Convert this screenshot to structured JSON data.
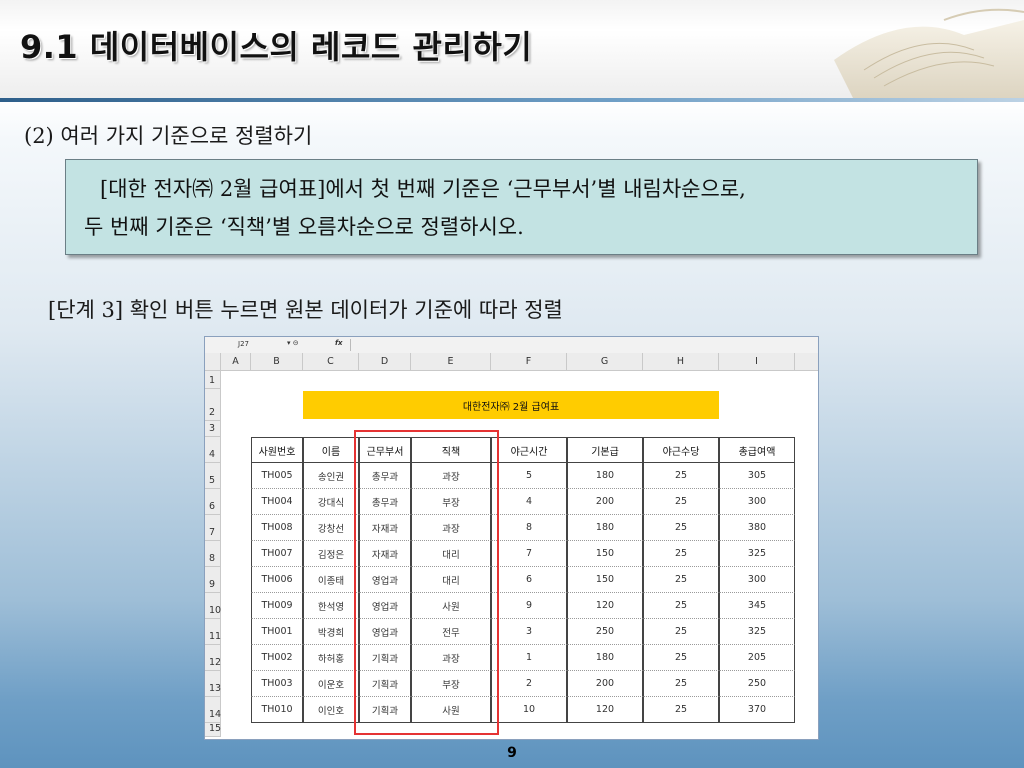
{
  "slide": {
    "title": "9.1 데이터베이스의 레코드 관리하기",
    "subtitle": "(2) 여러 가지 기준으로 정렬하기",
    "instruction_line1": "[대한 전자㈜ 2월 급여표]에서 첫 번째 기준은 ‘근무부서’별 내림차순으로,",
    "instruction_line2": "두 번째 기준은 ‘직책’별 오름차순으로 정렬하시오.",
    "step": "[단계 3] 확인 버튼 누르면 원본 데이터가 기준에 따라 정렬",
    "page_number": "9",
    "highlight_color": "#e53333"
  },
  "sheet": {
    "name_box": "J27",
    "fx_label": "fx",
    "columns": [
      "A",
      "B",
      "C",
      "D",
      "E",
      "F",
      "G",
      "H",
      "I"
    ],
    "rows": [
      "1",
      "2",
      "3",
      "4",
      "5",
      "6",
      "7",
      "8",
      "9",
      "10",
      "11",
      "12",
      "13",
      "14",
      "15"
    ],
    "table_title": "대한전자㈜ 2월 급여표",
    "title_fill": "#ffcc00",
    "headers": [
      "사원번호",
      "이름",
      "근무부서",
      "직책",
      "야근시간",
      "기본급",
      "야근수당",
      "총급여액"
    ],
    "records": [
      [
        "TH005",
        "송인권",
        "총무과",
        "과장",
        "5",
        "180",
        "25",
        "305"
      ],
      [
        "TH004",
        "강대식",
        "총무과",
        "부장",
        "4",
        "200",
        "25",
        "300"
      ],
      [
        "TH008",
        "강창선",
        "자재과",
        "과장",
        "8",
        "180",
        "25",
        "380"
      ],
      [
        "TH007",
        "김정은",
        "자재과",
        "대리",
        "7",
        "150",
        "25",
        "325"
      ],
      [
        "TH006",
        "이종태",
        "영업과",
        "대리",
        "6",
        "150",
        "25",
        "300"
      ],
      [
        "TH009",
        "한석영",
        "영업과",
        "사원",
        "9",
        "120",
        "25",
        "345"
      ],
      [
        "TH001",
        "박경희",
        "영업과",
        "전무",
        "3",
        "250",
        "25",
        "325"
      ],
      [
        "TH002",
        "하허홍",
        "기획과",
        "과장",
        "1",
        "180",
        "25",
        "205"
      ],
      [
        "TH003",
        "이운호",
        "기획과",
        "부장",
        "2",
        "200",
        "25",
        "250"
      ],
      [
        "TH010",
        "이인호",
        "기획과",
        "사원",
        "10",
        "120",
        "25",
        "370"
      ]
    ]
  }
}
